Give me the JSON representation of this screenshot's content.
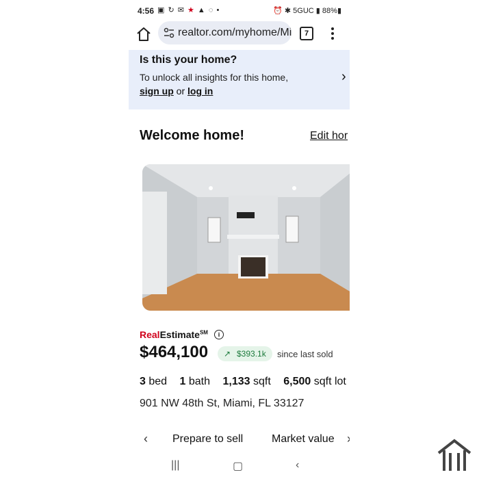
{
  "status": {
    "time": "4:56",
    "network": "5GUC",
    "battery": "88%"
  },
  "browser": {
    "url": "realtor.com/myhome/Mi",
    "tab_count": "7"
  },
  "banner": {
    "title": "Is this your home?",
    "text": "To unlock all insights for this home,",
    "sign_up": "sign up",
    "or": "or",
    "log_in": "log in"
  },
  "welcome": {
    "title": "Welcome home!",
    "edit": "Edit hor"
  },
  "estimate": {
    "brand_red": "Real",
    "brand_black": "Estimate",
    "brand_sup": "SM",
    "price": "$464,100",
    "change": "$393.1k",
    "since": "since last sold"
  },
  "facts": {
    "beds": "3",
    "beds_label": "bed",
    "baths": "1",
    "baths_label": "bath",
    "sqft": "1,133",
    "sqft_label": "sqft",
    "lot": "6,500",
    "lot_label": "sqft lot"
  },
  "address": "901 NW 48th St, Miami, FL 33127",
  "tabs": {
    "t1": "Prepare to sell",
    "t2": "Market value"
  },
  "colors": {
    "accent_red": "#d0021b",
    "banner_bg": "#e8eefa",
    "positive_green": "#1c7a3c"
  }
}
